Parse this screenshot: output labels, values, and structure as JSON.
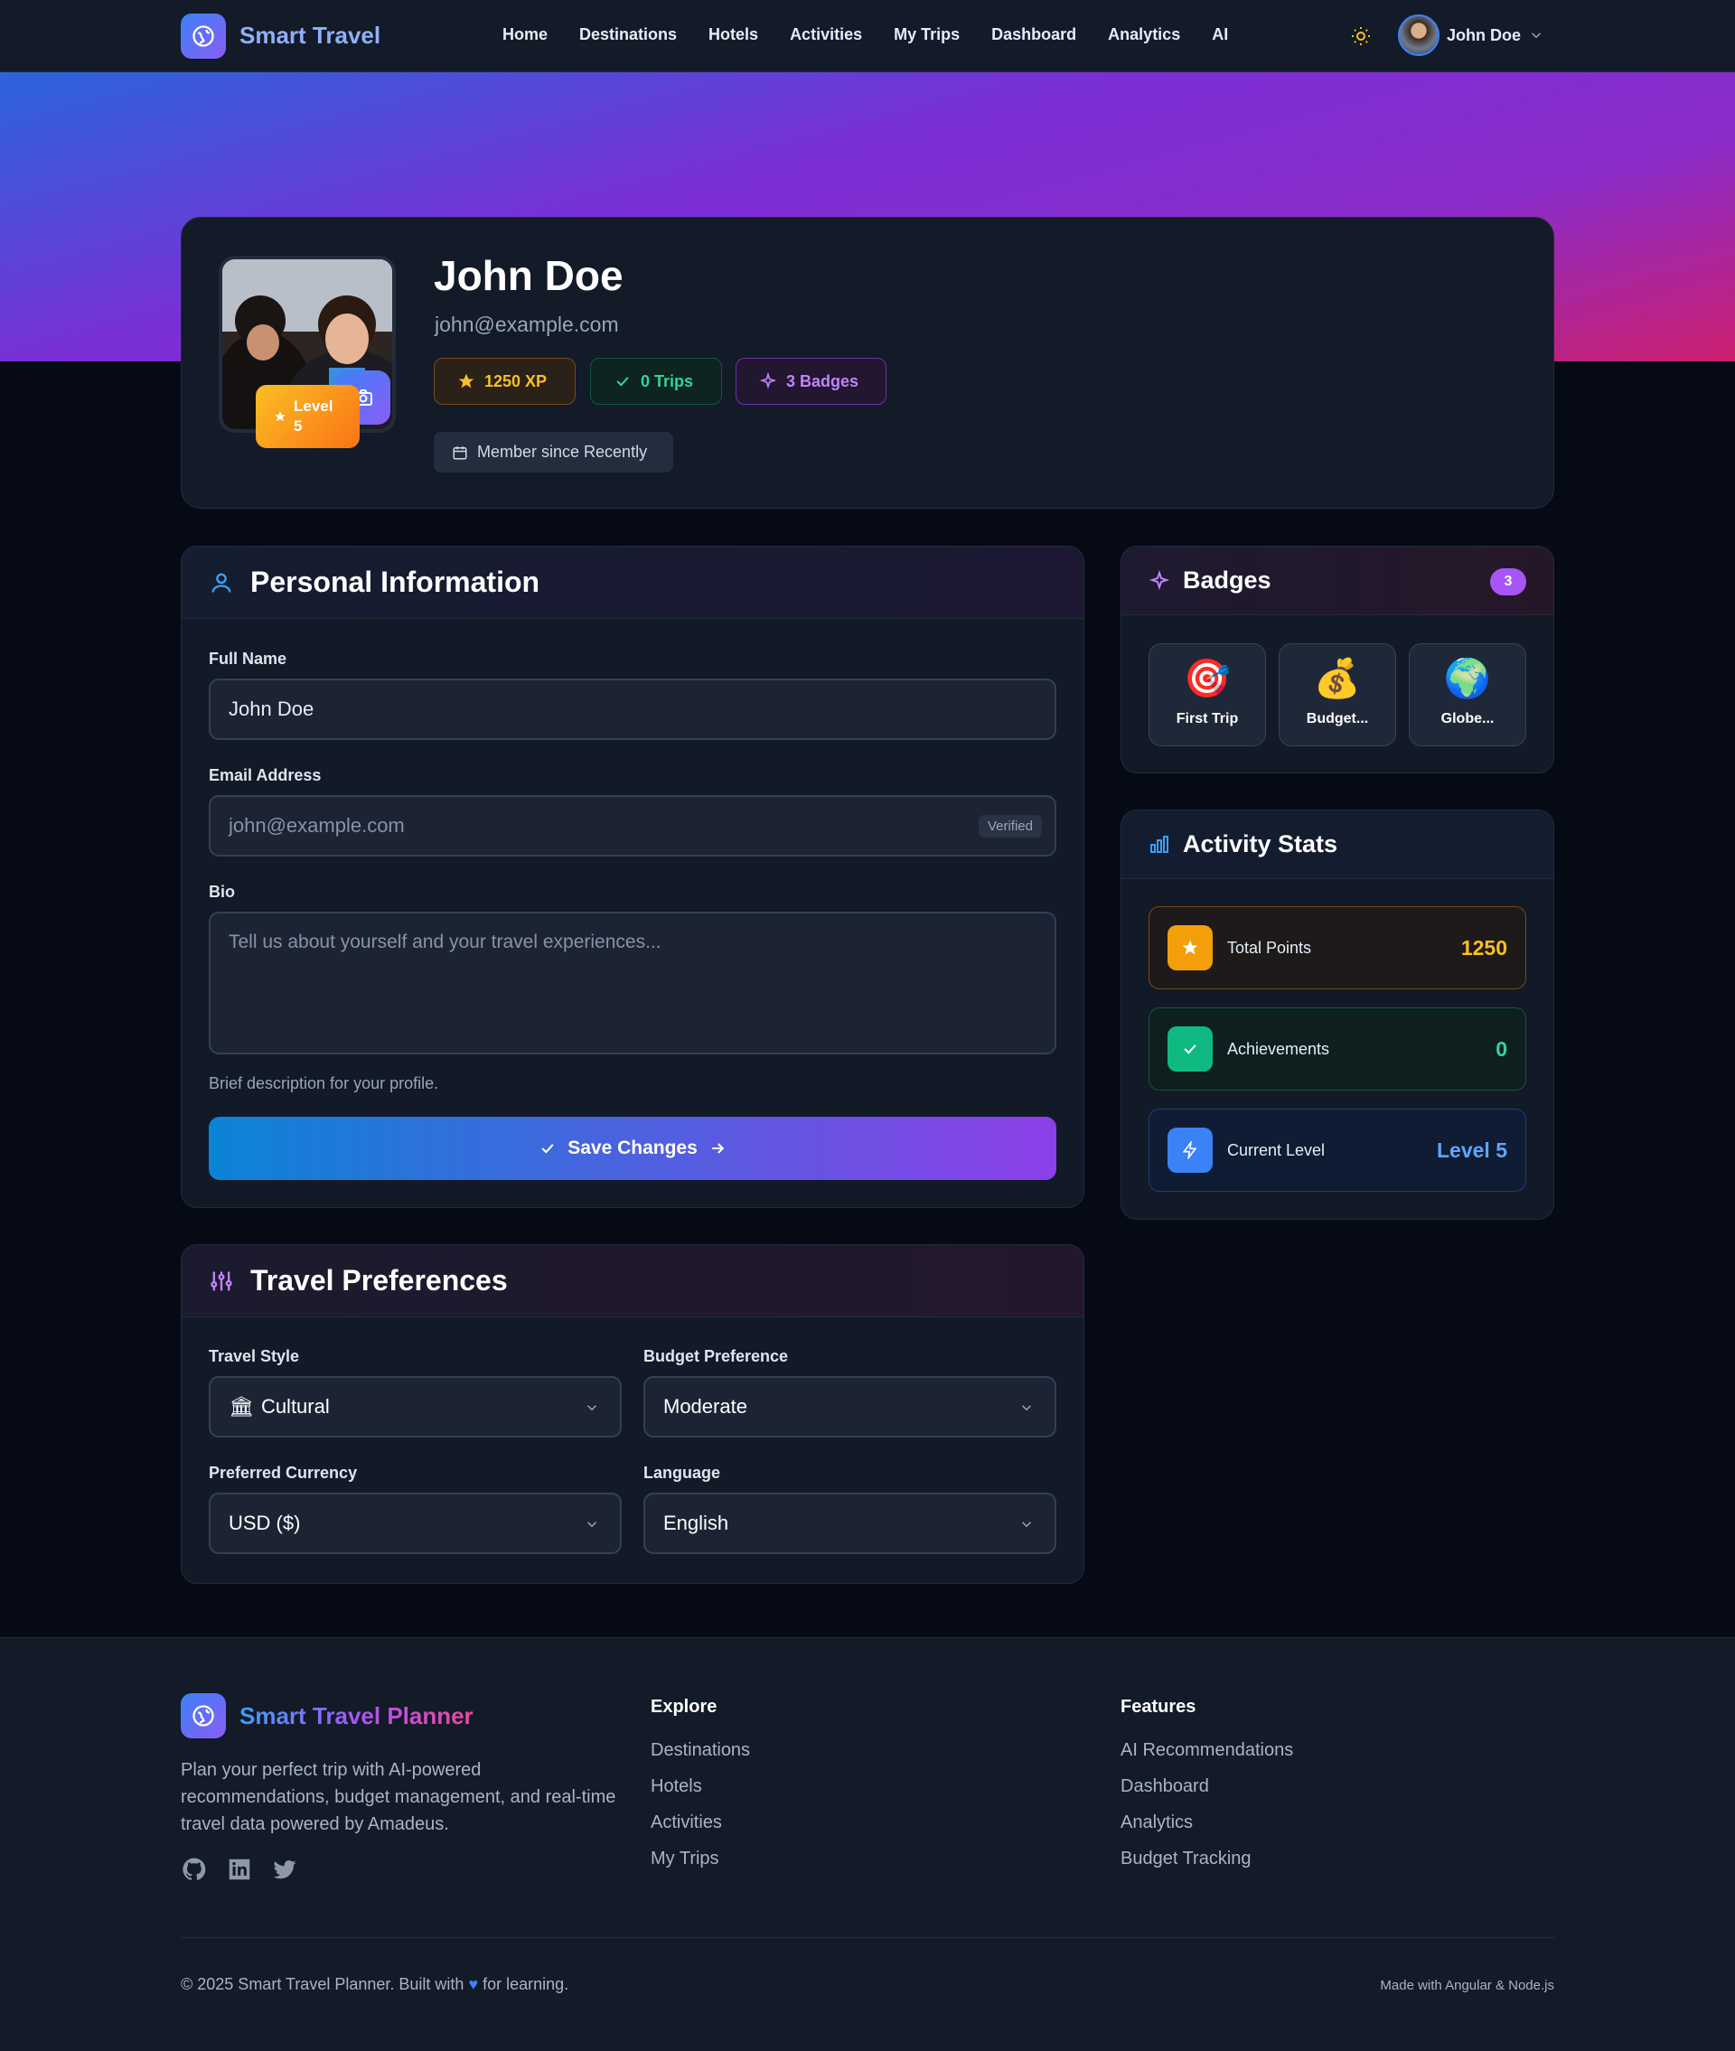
{
  "nav": {
    "brand": "Smart Travel",
    "links": [
      "Home",
      "Destinations",
      "Hotels",
      "Activities",
      "My Trips",
      "Dashboard",
      "Analytics",
      "AI"
    ],
    "user_name": "John Doe"
  },
  "profile": {
    "name": "John Doe",
    "email": "john@example.com",
    "level_word": "Level",
    "level_num": "5",
    "xp_chip": "1250 XP",
    "trips_chip": "0 Trips",
    "badges_chip": "3 Badges",
    "member_since": "Member since Recently"
  },
  "personal": {
    "title": "Personal Information",
    "full_name_label": "Full Name",
    "full_name_value": "John Doe",
    "email_label": "Email Address",
    "email_value": "john@example.com",
    "verified": "Verified",
    "bio_label": "Bio",
    "bio_placeholder": "Tell us about yourself and your travel experiences...",
    "bio_hint": "Brief description for your profile.",
    "save_label": "Save Changes"
  },
  "preferences": {
    "title": "Travel Preferences",
    "travel_style_label": "Travel Style",
    "travel_style_value": "Cultural",
    "budget_label": "Budget Preference",
    "budget_value": "Moderate",
    "currency_label": "Preferred Currency",
    "currency_value": "USD ($)",
    "language_label": "Language",
    "language_value": "English"
  },
  "badges": {
    "title": "Badges",
    "count": "3",
    "items": [
      {
        "emoji": "🎯",
        "label": "First Trip"
      },
      {
        "emoji": "💰",
        "label": "Budget..."
      },
      {
        "emoji": "🌍",
        "label": "Globe..."
      }
    ]
  },
  "stats": {
    "title": "Activity Stats",
    "items": [
      {
        "label": "Total Points",
        "value": "1250",
        "color": "#fbbf24"
      },
      {
        "label": "Achievements",
        "value": "0",
        "color": "#34d399"
      },
      {
        "label": "Current Level",
        "value": "Level 5",
        "color": "#60a5fa"
      }
    ]
  },
  "footer": {
    "brand": "Smart Travel Planner",
    "description": "Plan your perfect trip with AI-powered recommendations, budget management, and real-time travel data powered by Amadeus.",
    "explore_title": "Explore",
    "explore_links": [
      "Destinations",
      "Hotels",
      "Activities",
      "My Trips"
    ],
    "features_title": "Features",
    "features_links": [
      "AI Recommendations",
      "Dashboard",
      "Analytics",
      "Budget Tracking"
    ],
    "copyright_before": "© 2025 Smart Travel Planner. Built with",
    "copyright_after": "for learning.",
    "made_with": "Made with Angular & Node.js"
  }
}
